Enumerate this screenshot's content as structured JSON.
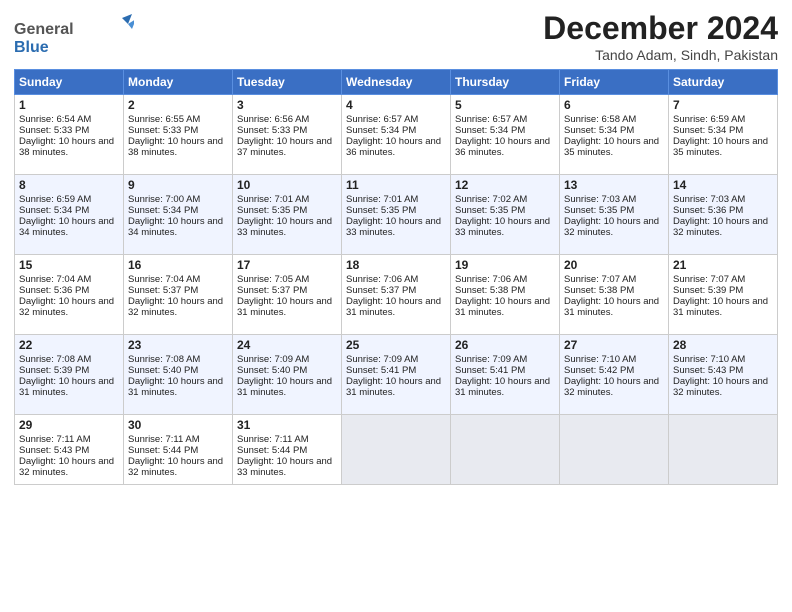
{
  "header": {
    "logo_general": "General",
    "logo_blue": "Blue",
    "title": "December 2024",
    "location": "Tando Adam, Sindh, Pakistan"
  },
  "columns": [
    "Sunday",
    "Monday",
    "Tuesday",
    "Wednesday",
    "Thursday",
    "Friday",
    "Saturday"
  ],
  "weeks": [
    [
      {
        "day": "1",
        "sunrise": "Sunrise: 6:54 AM",
        "sunset": "Sunset: 5:33 PM",
        "daylight": "Daylight: 10 hours and 38 minutes."
      },
      {
        "day": "2",
        "sunrise": "Sunrise: 6:55 AM",
        "sunset": "Sunset: 5:33 PM",
        "daylight": "Daylight: 10 hours and 38 minutes."
      },
      {
        "day": "3",
        "sunrise": "Sunrise: 6:56 AM",
        "sunset": "Sunset: 5:33 PM",
        "daylight": "Daylight: 10 hours and 37 minutes."
      },
      {
        "day": "4",
        "sunrise": "Sunrise: 6:57 AM",
        "sunset": "Sunset: 5:34 PM",
        "daylight": "Daylight: 10 hours and 36 minutes."
      },
      {
        "day": "5",
        "sunrise": "Sunrise: 6:57 AM",
        "sunset": "Sunset: 5:34 PM",
        "daylight": "Daylight: 10 hours and 36 minutes."
      },
      {
        "day": "6",
        "sunrise": "Sunrise: 6:58 AM",
        "sunset": "Sunset: 5:34 PM",
        "daylight": "Daylight: 10 hours and 35 minutes."
      },
      {
        "day": "7",
        "sunrise": "Sunrise: 6:59 AM",
        "sunset": "Sunset: 5:34 PM",
        "daylight": "Daylight: 10 hours and 35 minutes."
      }
    ],
    [
      {
        "day": "8",
        "sunrise": "Sunrise: 6:59 AM",
        "sunset": "Sunset: 5:34 PM",
        "daylight": "Daylight: 10 hours and 34 minutes."
      },
      {
        "day": "9",
        "sunrise": "Sunrise: 7:00 AM",
        "sunset": "Sunset: 5:34 PM",
        "daylight": "Daylight: 10 hours and 34 minutes."
      },
      {
        "day": "10",
        "sunrise": "Sunrise: 7:01 AM",
        "sunset": "Sunset: 5:35 PM",
        "daylight": "Daylight: 10 hours and 33 minutes."
      },
      {
        "day": "11",
        "sunrise": "Sunrise: 7:01 AM",
        "sunset": "Sunset: 5:35 PM",
        "daylight": "Daylight: 10 hours and 33 minutes."
      },
      {
        "day": "12",
        "sunrise": "Sunrise: 7:02 AM",
        "sunset": "Sunset: 5:35 PM",
        "daylight": "Daylight: 10 hours and 33 minutes."
      },
      {
        "day": "13",
        "sunrise": "Sunrise: 7:03 AM",
        "sunset": "Sunset: 5:35 PM",
        "daylight": "Daylight: 10 hours and 32 minutes."
      },
      {
        "day": "14",
        "sunrise": "Sunrise: 7:03 AM",
        "sunset": "Sunset: 5:36 PM",
        "daylight": "Daylight: 10 hours and 32 minutes."
      }
    ],
    [
      {
        "day": "15",
        "sunrise": "Sunrise: 7:04 AM",
        "sunset": "Sunset: 5:36 PM",
        "daylight": "Daylight: 10 hours and 32 minutes."
      },
      {
        "day": "16",
        "sunrise": "Sunrise: 7:04 AM",
        "sunset": "Sunset: 5:37 PM",
        "daylight": "Daylight: 10 hours and 32 minutes."
      },
      {
        "day": "17",
        "sunrise": "Sunrise: 7:05 AM",
        "sunset": "Sunset: 5:37 PM",
        "daylight": "Daylight: 10 hours and 31 minutes."
      },
      {
        "day": "18",
        "sunrise": "Sunrise: 7:06 AM",
        "sunset": "Sunset: 5:37 PM",
        "daylight": "Daylight: 10 hours and 31 minutes."
      },
      {
        "day": "19",
        "sunrise": "Sunrise: 7:06 AM",
        "sunset": "Sunset: 5:38 PM",
        "daylight": "Daylight: 10 hours and 31 minutes."
      },
      {
        "day": "20",
        "sunrise": "Sunrise: 7:07 AM",
        "sunset": "Sunset: 5:38 PM",
        "daylight": "Daylight: 10 hours and 31 minutes."
      },
      {
        "day": "21",
        "sunrise": "Sunrise: 7:07 AM",
        "sunset": "Sunset: 5:39 PM",
        "daylight": "Daylight: 10 hours and 31 minutes."
      }
    ],
    [
      {
        "day": "22",
        "sunrise": "Sunrise: 7:08 AM",
        "sunset": "Sunset: 5:39 PM",
        "daylight": "Daylight: 10 hours and 31 minutes."
      },
      {
        "day": "23",
        "sunrise": "Sunrise: 7:08 AM",
        "sunset": "Sunset: 5:40 PM",
        "daylight": "Daylight: 10 hours and 31 minutes."
      },
      {
        "day": "24",
        "sunrise": "Sunrise: 7:09 AM",
        "sunset": "Sunset: 5:40 PM",
        "daylight": "Daylight: 10 hours and 31 minutes."
      },
      {
        "day": "25",
        "sunrise": "Sunrise: 7:09 AM",
        "sunset": "Sunset: 5:41 PM",
        "daylight": "Daylight: 10 hours and 31 minutes."
      },
      {
        "day": "26",
        "sunrise": "Sunrise: 7:09 AM",
        "sunset": "Sunset: 5:41 PM",
        "daylight": "Daylight: 10 hours and 31 minutes."
      },
      {
        "day": "27",
        "sunrise": "Sunrise: 7:10 AM",
        "sunset": "Sunset: 5:42 PM",
        "daylight": "Daylight: 10 hours and 32 minutes."
      },
      {
        "day": "28",
        "sunrise": "Sunrise: 7:10 AM",
        "sunset": "Sunset: 5:43 PM",
        "daylight": "Daylight: 10 hours and 32 minutes."
      }
    ],
    [
      {
        "day": "29",
        "sunrise": "Sunrise: 7:11 AM",
        "sunset": "Sunset: 5:43 PM",
        "daylight": "Daylight: 10 hours and 32 minutes."
      },
      {
        "day": "30",
        "sunrise": "Sunrise: 7:11 AM",
        "sunset": "Sunset: 5:44 PM",
        "daylight": "Daylight: 10 hours and 32 minutes."
      },
      {
        "day": "31",
        "sunrise": "Sunrise: 7:11 AM",
        "sunset": "Sunset: 5:44 PM",
        "daylight": "Daylight: 10 hours and 33 minutes."
      },
      null,
      null,
      null,
      null
    ]
  ]
}
